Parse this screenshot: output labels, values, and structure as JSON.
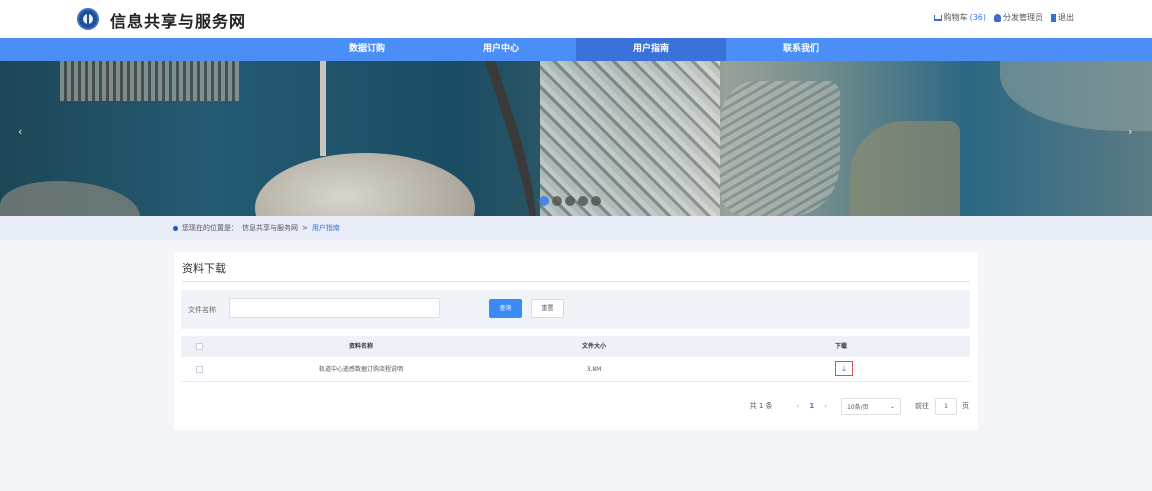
{
  "header": {
    "site_title": "信息共享与服务网",
    "cart_label": "购物车",
    "cart_count": "(36)",
    "user_label": "分发管理员",
    "logout_label": "退出"
  },
  "nav": {
    "items": [
      {
        "label": "数据订购"
      },
      {
        "label": "用户中心"
      },
      {
        "label": "用户指南"
      },
      {
        "label": "联系我们"
      }
    ],
    "active_index": 2
  },
  "banner": {
    "prev_icon": "‹",
    "next_icon": "›",
    "slide_count": 5,
    "active_slide": 0
  },
  "breadcrumb": {
    "prefix": "您现在的位置是：",
    "home": "信息共享与服务网",
    "separator": " > ",
    "current": "用户指南"
  },
  "section": {
    "title": "资料下载"
  },
  "search": {
    "label": "文件名称",
    "value": "",
    "placeholder": "",
    "query_button": "查询",
    "reset_button": "重置"
  },
  "table": {
    "columns": {
      "name": "资料名称",
      "size": "文件大小",
      "download": "下载"
    },
    "rows": [
      {
        "name": "轨道中心遥感数据订购流程说明",
        "size": "3.8M",
        "download_icon": "download-icon"
      }
    ]
  },
  "pagination": {
    "total": "共 1 条",
    "current_page": "1",
    "page_size": "10条/页",
    "goto_label": "前往",
    "goto_value": "1",
    "page_unit": "页"
  },
  "colors": {
    "nav_bg": "#4c8ef7",
    "nav_active": "#3a72d9",
    "primary": "#3b8af7",
    "highlight_border": "#e84b4b"
  }
}
